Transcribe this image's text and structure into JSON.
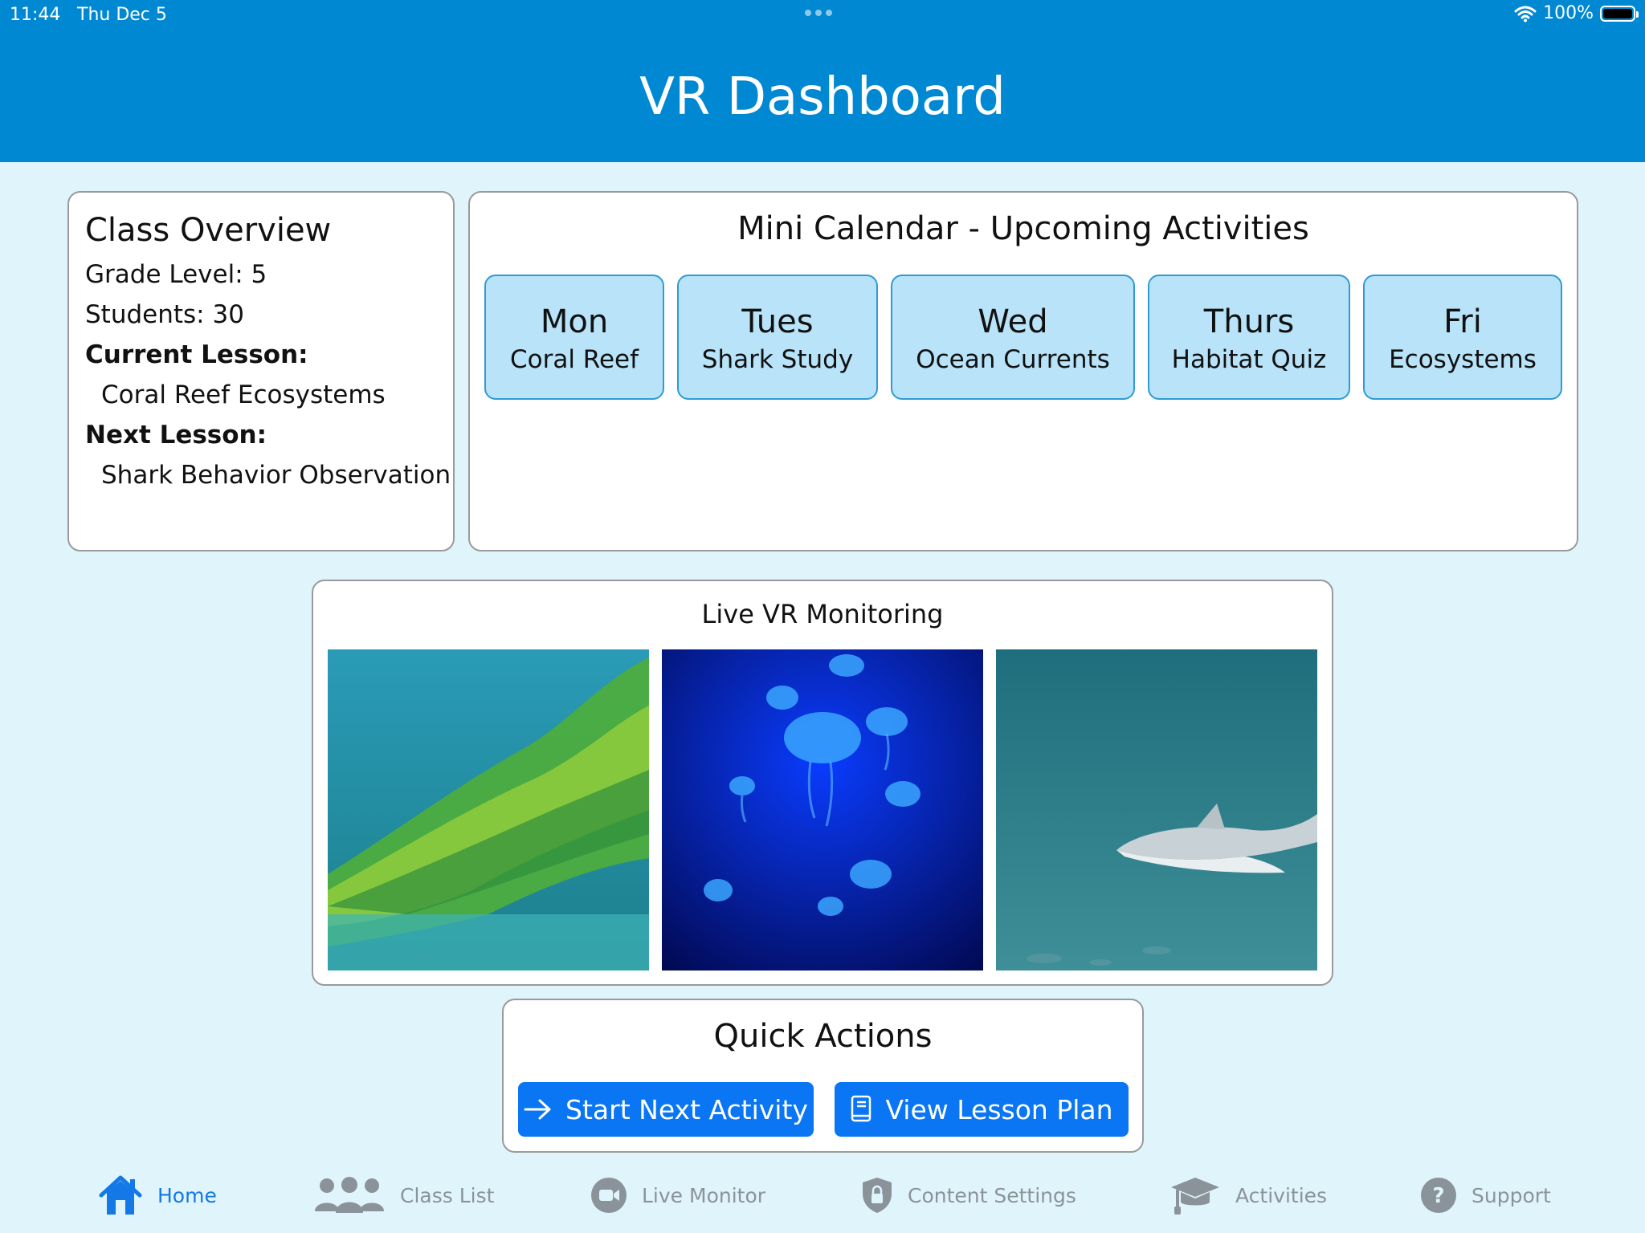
{
  "status_bar": {
    "time": "11:44",
    "date": "Thu Dec 5",
    "battery": "100%"
  },
  "header": {
    "title": "VR Dashboard"
  },
  "class_overview": {
    "heading": "Class Overview",
    "grade_level": "Grade Level: 5",
    "students": "Students: 30",
    "current_lesson_label": "Current Lesson:",
    "current_lesson": "Coral Reef Ecosystems",
    "next_lesson_label": "Next Lesson:",
    "next_lesson": "Shark Behavior Observation"
  },
  "calendar": {
    "heading": "Mini Calendar - Upcoming Activities",
    "days": [
      {
        "day": "Mon",
        "activity": "Coral Reef"
      },
      {
        "day": "Tues",
        "activity": "Shark Study"
      },
      {
        "day": "Wed",
        "activity": "Ocean Currents"
      },
      {
        "day": "Thurs",
        "activity": "Habitat Quiz"
      },
      {
        "day": "Fri",
        "activity": "Ecosystems"
      }
    ]
  },
  "monitor": {
    "heading": "Live VR Monitoring"
  },
  "quick_actions": {
    "heading": "Quick Actions",
    "start_next": "Start Next Activity",
    "view_plan": "View Lesson Plan"
  },
  "tabs": [
    {
      "label": "Home",
      "icon": "house-icon"
    },
    {
      "label": "Class List",
      "icon": "people-icon"
    },
    {
      "label": "Live Monitor",
      "icon": "video-camera-icon"
    },
    {
      "label": "Content Settings",
      "icon": "shield-icon"
    },
    {
      "label": "Activities",
      "icon": "graduation-cap-icon"
    },
    {
      "label": "Support",
      "icon": "question-icon"
    }
  ],
  "colors": {
    "header": "#0188d2",
    "background": "#e0f5fb",
    "day_tile": "#b8e3f8",
    "button": "#0a76f4",
    "tab_active": "#1478e6",
    "tab_inactive": "#8b939a"
  }
}
